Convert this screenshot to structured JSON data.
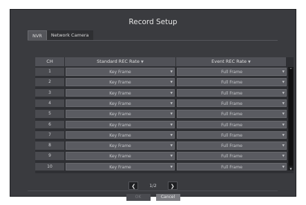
{
  "dialog": {
    "title": "Record Setup"
  },
  "tabs": [
    {
      "label": "NVR",
      "active": true
    },
    {
      "label": "Network Camera",
      "active": false
    }
  ],
  "table": {
    "headers": {
      "ch": "CH",
      "standard": "Standard REC Rate",
      "event": "Event REC Rate"
    },
    "rows": [
      {
        "ch": "1",
        "standard": "Key Frame",
        "event": "Full Frame"
      },
      {
        "ch": "2",
        "standard": "Key Frame",
        "event": "Full Frame"
      },
      {
        "ch": "3",
        "standard": "Key Frame",
        "event": "Full Frame"
      },
      {
        "ch": "4",
        "standard": "Key Frame",
        "event": "Full Frame"
      },
      {
        "ch": "5",
        "standard": "Key Frame",
        "event": "Full Frame"
      },
      {
        "ch": "6",
        "standard": "Key Frame",
        "event": "Full Frame"
      },
      {
        "ch": "7",
        "standard": "Key Frame",
        "event": "Full Frame"
      },
      {
        "ch": "8",
        "standard": "Key Frame",
        "event": "Full Frame"
      },
      {
        "ch": "9",
        "standard": "Key Frame",
        "event": "Full Frame"
      },
      {
        "ch": "10",
        "standard": "Key Frame",
        "event": "Full Frame"
      }
    ]
  },
  "pager": {
    "text": "1/2",
    "prev_icon": "chevron-left-icon",
    "next_icon": "chevron-right-icon"
  },
  "buttons": {
    "ok": "OK",
    "cancel": "Cancel"
  },
  "colors": {
    "dialog_bg": "#3a3b3f",
    "cell_bg": "#5a5b61",
    "header_bg": "#505157"
  }
}
